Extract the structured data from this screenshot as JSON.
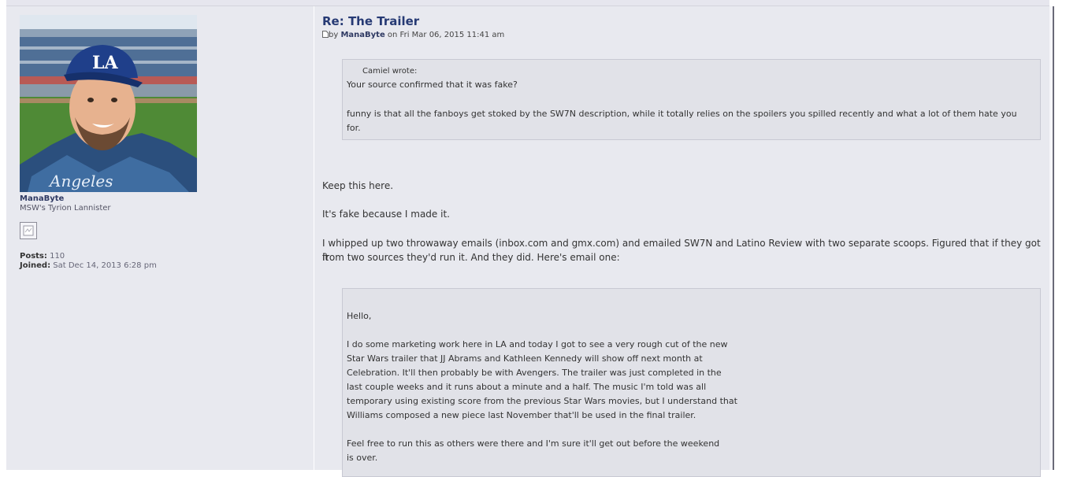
{
  "author": {
    "username": "ManaByte",
    "rank": "MSW's Tyrion Lannister",
    "posts_label": "Posts:",
    "posts_value": "110",
    "joined_label": "Joined:",
    "joined_value": "Sat Dec 14, 2013 6:28 pm",
    "avatar_icon": "avatar-photo",
    "pm_icon": "message-icon"
  },
  "post": {
    "title": "Re: The Trailer",
    "meta_prefix": "by",
    "meta_user": "ManaByte",
    "meta_on": "on Fri Mar 06, 2015 11:41 am",
    "post_icon": "post-icon"
  },
  "quote1": {
    "author_line": "Camiel wrote:",
    "line1": "Your source confirmed that it was fake?",
    "line2a": "funny is that all the fanboys get stoked by the SW7N description, while it totally relies on the spoilers you spilled recently and what a lot of them hate you",
    "line2b": "for."
  },
  "body": {
    "p1": "Keep this here.",
    "p2": "It's fake because I made it.",
    "p3a": "I whipped up two throwaway emails (inbox.com and gmx.com) and emailed SW7N and Latino Review with two separate scoops. Figured that if they got it",
    "p3b": "from two sources they'd run it. And they did. Here's email one:"
  },
  "quote2": {
    "greeting": "Hello,",
    "lines": [
      "I do some marketing work here in LA and today I got to see a very rough cut of the new",
      "Star Wars trailer that JJ Abrams and Kathleen Kennedy will show off next month at",
      "Celebration. It'll then probably be with Avengers. The trailer was just completed in the",
      "last couple weeks and it runs about a minute and a half. The music I'm told was all",
      "temporary using existing score from the previous Star Wars movies, but I understand that",
      "Williams composed a new piece last November that'll be used in the final trailer."
    ],
    "lines2": [
      "Feel free to run this as others were there and I'm sure it'll get out before the weekend",
      "is over."
    ]
  }
}
